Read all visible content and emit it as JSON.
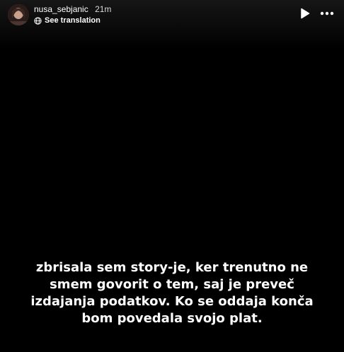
{
  "header": {
    "username": "nusa_sebjanic",
    "time_ago": "21m",
    "see_translation": "See translation",
    "play_icon": "play-icon",
    "more_icon": "more-horizontal-icon",
    "globe_icon": "globe-icon"
  },
  "caption": {
    "lines": [
      "zbrisala sem story-je, ker trenutno ne",
      "smem govorit o tem, saj je preveč",
      "izdajanja podatkov. Ko se oddaja konča",
      "bom povedala svojo plat."
    ]
  },
  "colors": {
    "background": "#000000",
    "text": "#ffffff",
    "muted_text": "#d8d8d8"
  }
}
